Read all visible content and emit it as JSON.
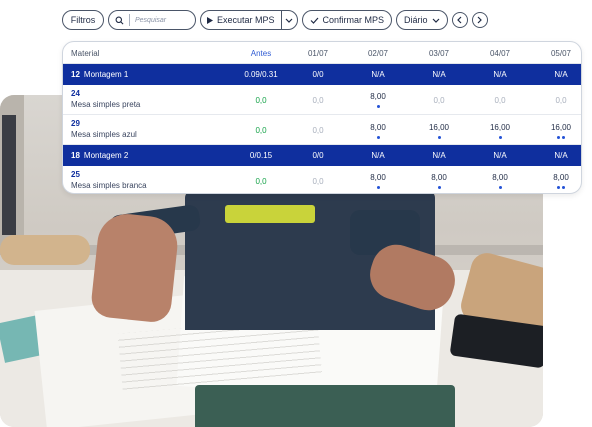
{
  "toolbar": {
    "filters_label": "Filtros",
    "search_placeholder": "Pesquisar",
    "execute_label": "Executar MPS",
    "confirm_label": "Confirmar MPS",
    "period_label": "Diário"
  },
  "grid": {
    "headers": {
      "material": "Material",
      "antes": "Antes",
      "d1": "01/07",
      "d2": "02/07",
      "d3": "03/07",
      "d4": "04/07",
      "d5": "05/07"
    },
    "groups": [
      {
        "code": "12",
        "name": "Montagem 1",
        "antes": "0.09/0.31",
        "d1": "0/0",
        "d2": "N/A",
        "d3": "N/A",
        "d4": "N/A",
        "d5": "N/A",
        "items": [
          {
            "code": "24",
            "name": "Mesa simples preta",
            "antes": "0,0",
            "d1": "0,0",
            "d2": "8,00",
            "d3": "0,0",
            "d4": "0,0",
            "d5": "0,0"
          },
          {
            "code": "29",
            "name": "Mesa simples azul",
            "antes": "0,0",
            "d1": "0,0",
            "d2": "8,00",
            "d3": "16,00",
            "d4": "16,00",
            "d5": "16,00"
          }
        ]
      },
      {
        "code": "18",
        "name": "Montagem 2",
        "antes": "0/0.15",
        "d1": "0/0",
        "d2": "N/A",
        "d3": "N/A",
        "d4": "N/A",
        "d5": "N/A",
        "items": [
          {
            "code": "25",
            "name": "Mesa simples branca",
            "antes": "0,0",
            "d1": "0,0",
            "d2": "8,00",
            "d3": "8,00",
            "d4": "8,00",
            "d5": "8,00"
          }
        ]
      }
    ]
  },
  "colors": {
    "group_row": "#0f2f9e",
    "accent_blue": "#2f5bd3",
    "positive_green": "#17a34a",
    "muted": "#a9b0bd"
  }
}
